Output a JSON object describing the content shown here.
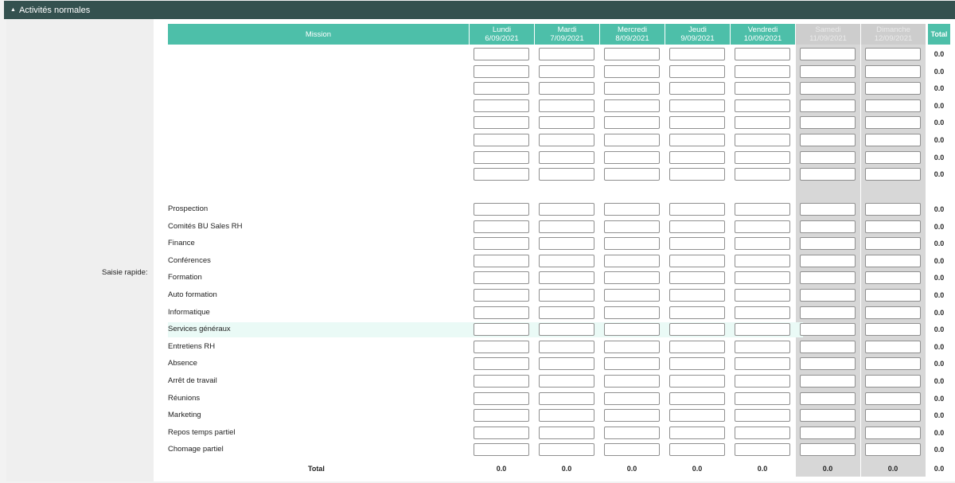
{
  "section": {
    "title": "Activités normales"
  },
  "quick_label": "Saisie rapide:",
  "columns": {
    "mission": "Mission",
    "days": [
      {
        "day": "Lundi",
        "date": "6/09/2021",
        "weekend": false
      },
      {
        "day": "Mardi",
        "date": "7/09/2021",
        "weekend": false
      },
      {
        "day": "Mercredi",
        "date": "8/09/2021",
        "weekend": false
      },
      {
        "day": "Jeudi",
        "date": "9/09/2021",
        "weekend": false
      },
      {
        "day": "Vendredi",
        "date": "10/09/2021",
        "weekend": false
      },
      {
        "day": "Samedi",
        "date": "11/09/2021",
        "weekend": true
      },
      {
        "day": "Dimanche",
        "date": "12/09/2021",
        "weekend": true
      }
    ],
    "total": "Total"
  },
  "rows": [
    {
      "label": "",
      "total": "0.0"
    },
    {
      "label": "",
      "total": "0.0"
    },
    {
      "label": "",
      "total": "0.0"
    },
    {
      "label": "",
      "total": "0.0"
    },
    {
      "label": "",
      "total": "0.0"
    },
    {
      "label": "",
      "total": "0.0"
    },
    {
      "label": "",
      "total": "0.0"
    },
    {
      "label": "",
      "total": "0.0"
    },
    {
      "label": "Prospection",
      "total": "0.0"
    },
    {
      "label": "Comités BU Sales RH",
      "total": "0.0"
    },
    {
      "label": "Finance",
      "total": "0.0"
    },
    {
      "label": "Conférences",
      "total": "0.0"
    },
    {
      "label": "Formation",
      "total": "0.0"
    },
    {
      "label": "Auto formation",
      "total": "0.0"
    },
    {
      "label": "Informatique",
      "total": "0.0"
    },
    {
      "label": "Services généraux",
      "total": "0.0",
      "highlight": true
    },
    {
      "label": "Entretiens RH",
      "total": "0.0"
    },
    {
      "label": "Absence",
      "total": "0.0"
    },
    {
      "label": "Arrêt de travail",
      "total": "0.0"
    },
    {
      "label": "Réunions",
      "total": "0.0"
    },
    {
      "label": "Marketing",
      "total": "0.0"
    },
    {
      "label": "Repos temps partiel",
      "total": "0.0"
    },
    {
      "label": "Chomage partiel",
      "total": "0.0"
    }
  ],
  "totals": {
    "label": "Total",
    "days": [
      "0.0",
      "0.0",
      "0.0",
      "0.0",
      "0.0",
      "0.0",
      "0.0"
    ],
    "grand": "0.0"
  },
  "colors": {
    "header": "#34514f",
    "accent": "#4dbfa9",
    "weekend": "#cdcdcd",
    "highlight": "#eafaf6"
  }
}
